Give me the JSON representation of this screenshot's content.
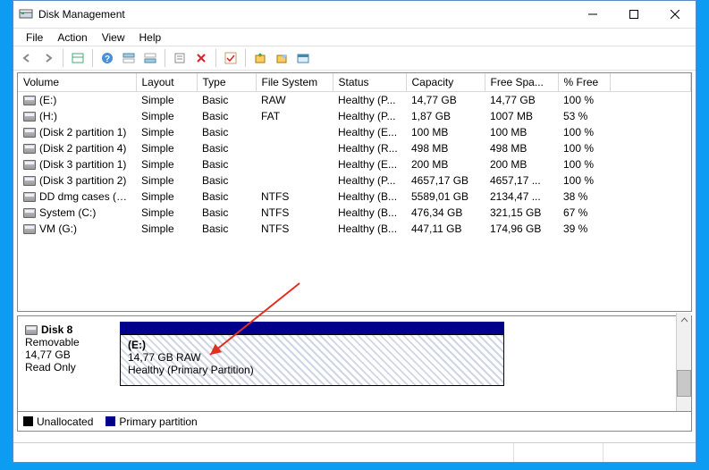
{
  "window": {
    "title": "Disk Management"
  },
  "menu": {
    "file": "File",
    "action": "Action",
    "view": "View",
    "help": "Help"
  },
  "columns": [
    "Volume",
    "Layout",
    "Type",
    "File System",
    "Status",
    "Capacity",
    "Free Spa...",
    "% Free"
  ],
  "volumes": [
    {
      "name": "(E:)",
      "layout": "Simple",
      "type": "Basic",
      "fs": "RAW",
      "status": "Healthy (P...",
      "capacity": "14,77 GB",
      "free": "14,77 GB",
      "pct": "100 %"
    },
    {
      "name": "(H:)",
      "layout": "Simple",
      "type": "Basic",
      "fs": "FAT",
      "status": "Healthy (P...",
      "capacity": "1,87 GB",
      "free": "1007 MB",
      "pct": "53 %"
    },
    {
      "name": "(Disk 2 partition 1)",
      "layout": "Simple",
      "type": "Basic",
      "fs": "",
      "status": "Healthy (E...",
      "capacity": "100 MB",
      "free": "100 MB",
      "pct": "100 %"
    },
    {
      "name": "(Disk 2 partition 4)",
      "layout": "Simple",
      "type": "Basic",
      "fs": "",
      "status": "Healthy (R...",
      "capacity": "498 MB",
      "free": "498 MB",
      "pct": "100 %"
    },
    {
      "name": "(Disk 3 partition 1)",
      "layout": "Simple",
      "type": "Basic",
      "fs": "",
      "status": "Healthy (E...",
      "capacity": "200 MB",
      "free": "200 MB",
      "pct": "100 %"
    },
    {
      "name": "(Disk 3 partition 2)",
      "layout": "Simple",
      "type": "Basic",
      "fs": "",
      "status": "Healthy (P...",
      "capacity": "4657,17 GB",
      "free": "4657,17 ...",
      "pct": "100 %"
    },
    {
      "name": "DD dmg cases (D:)",
      "layout": "Simple",
      "type": "Basic",
      "fs": "NTFS",
      "status": "Healthy (B...",
      "capacity": "5589,01 GB",
      "free": "2134,47 ...",
      "pct": "38 %"
    },
    {
      "name": "System (C:)",
      "layout": "Simple",
      "type": "Basic",
      "fs": "NTFS",
      "status": "Healthy (B...",
      "capacity": "476,34 GB",
      "free": "321,15 GB",
      "pct": "67 %"
    },
    {
      "name": "VM (G:)",
      "layout": "Simple",
      "type": "Basic",
      "fs": "NTFS",
      "status": "Healthy (B...",
      "capacity": "447,11 GB",
      "free": "174,96 GB",
      "pct": "39 %"
    }
  ],
  "disk_panel": {
    "name": "Disk 8",
    "kind": "Removable",
    "size": "14,77 GB",
    "mode": "Read Only",
    "part_name": "(E:)",
    "part_info": "14,77 GB RAW",
    "part_status": "Healthy (Primary Partition)"
  },
  "legend": {
    "unalloc": "Unallocated",
    "primary": "Primary partition"
  },
  "colors": {
    "navy": "#00008b",
    "black": "#000000"
  }
}
